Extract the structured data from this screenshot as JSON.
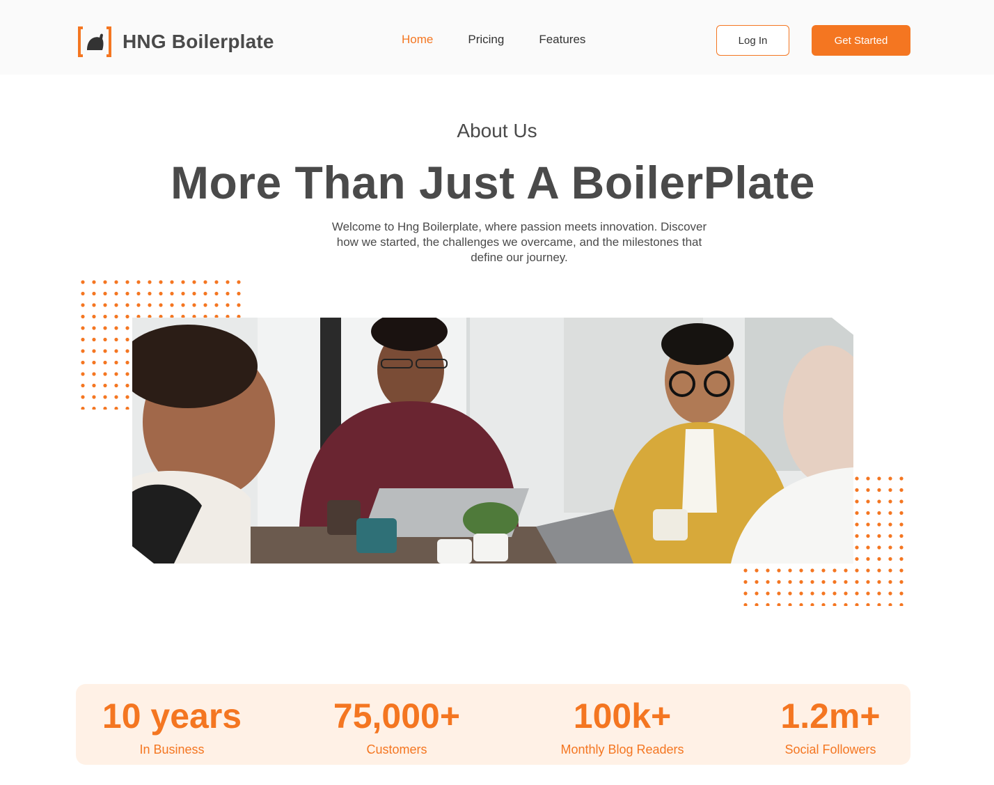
{
  "header": {
    "brand": "HNG Boilerplate",
    "nav": [
      {
        "label": "Home",
        "active": true
      },
      {
        "label": "Pricing",
        "active": false
      },
      {
        "label": "Features",
        "active": false
      }
    ],
    "login_label": "Log In",
    "cta_label": "Get Started"
  },
  "hero": {
    "eyebrow": "About Us",
    "headline": "More Than Just A BoilerPlate",
    "subtext": "Welcome to Hng Boilerplate, where passion meets innovation. Discover how we started, the challenges we overcame, and the milestones that define our journey."
  },
  "stats": [
    {
      "value": "10 years",
      "label": "In Business"
    },
    {
      "value": "75,000+",
      "label": "Customers"
    },
    {
      "value": "100k+",
      "label": "Monthly Blog Readers"
    },
    {
      "value": "1.2m+",
      "label": "Social Followers"
    }
  ],
  "colors": {
    "accent": "#f47621",
    "text": "#4a4a4a",
    "stats_bg": "#fff1e6",
    "header_bg": "#fafafa"
  }
}
